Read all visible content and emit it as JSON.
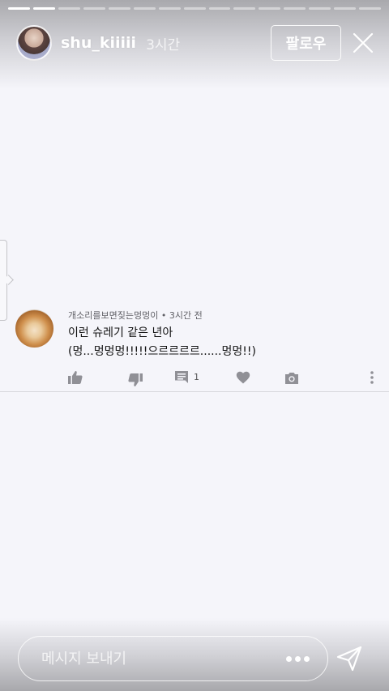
{
  "story": {
    "progress": {
      "total_segments": 15,
      "completed_segments": 2
    },
    "username": "shu_kiiiii",
    "time": "3시간",
    "follow_label": "팔로우"
  },
  "comment": {
    "author": "개소리를보면짖는멍멍이",
    "separator": "•",
    "time": "3시간 전",
    "text_line1": "이런 슈레기 같은 년아",
    "text_line2": "(멍...멍멍멍!!!!!으르르르르......멍멍!!)",
    "reply_count": "1"
  },
  "message": {
    "placeholder": "메시지 보내기"
  },
  "icons": {
    "close": "close-icon",
    "like": "thumbs-up-icon",
    "dislike": "thumbs-down-icon",
    "reply": "comment-icon",
    "heart": "heart-icon",
    "camera": "camera-icon",
    "more": "more-vertical-icon",
    "send": "send-icon",
    "dots": "more-horizontal-icon"
  },
  "colors": {
    "background": "#f5f5fa",
    "icon_gray": "#909096"
  }
}
